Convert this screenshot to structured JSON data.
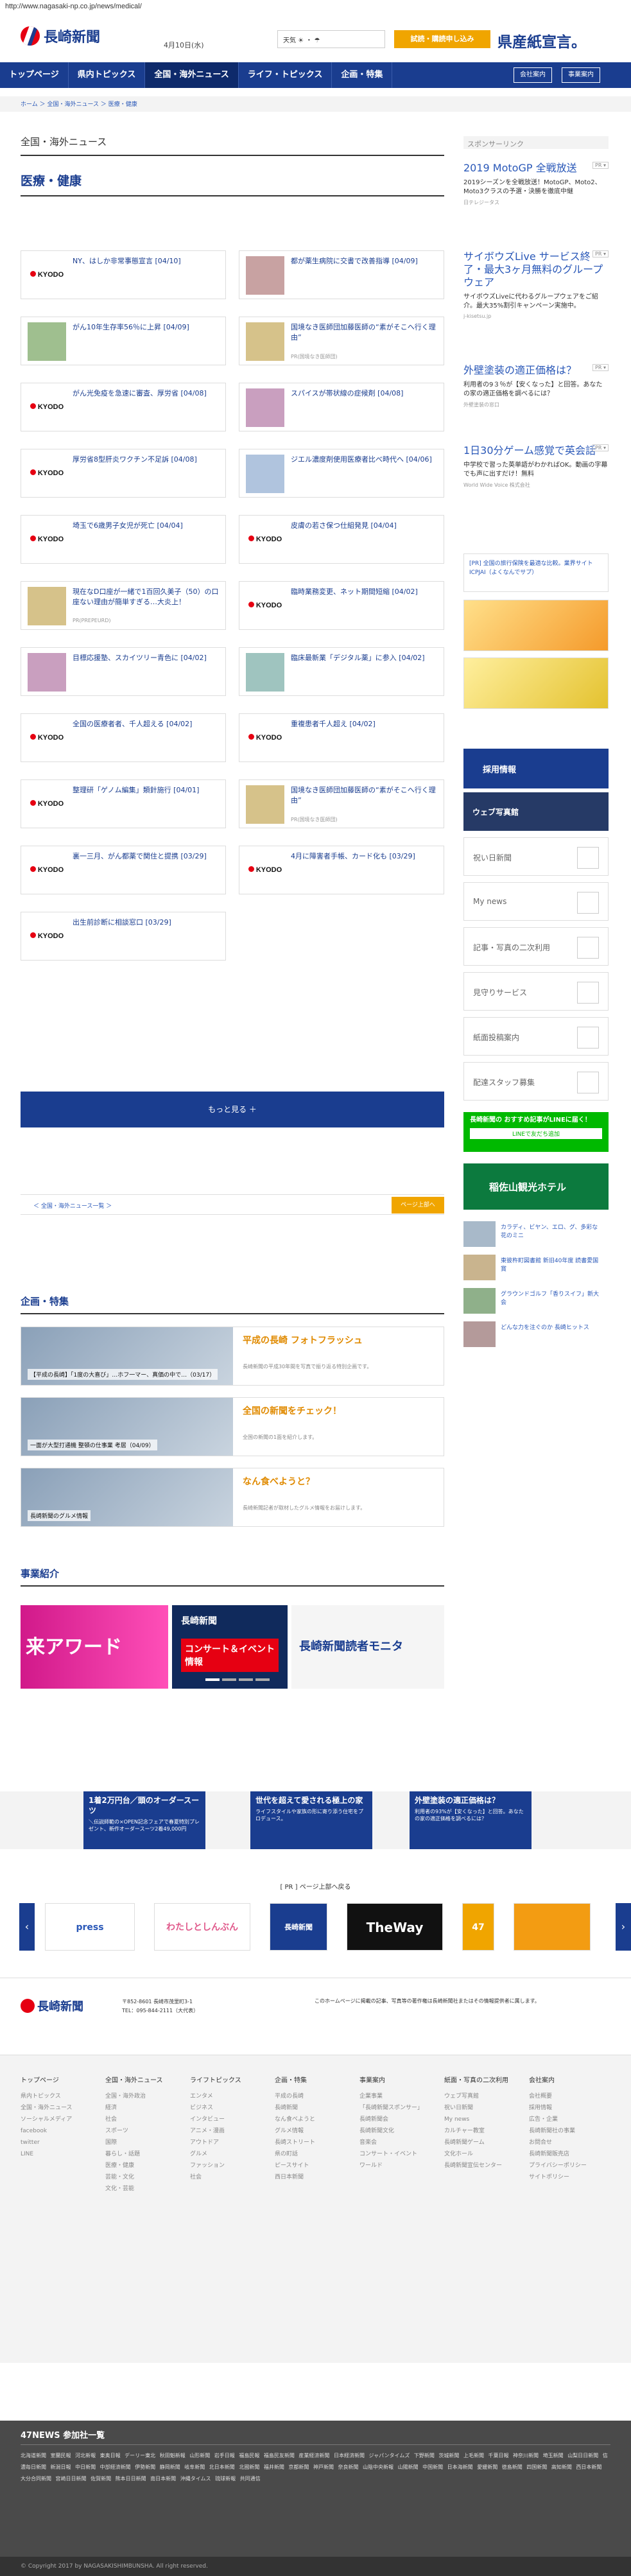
{
  "browser": {
    "url": "http://www.nagasaki-np.co.jp/news/medical/"
  },
  "header": {
    "logo_text": "長崎新聞",
    "date": "4月10日(水)",
    "weather_label": "天気",
    "trial_label": "試読・購読申し込み",
    "ad_text": "県産紙宣言。"
  },
  "nav": {
    "items": [
      "トップページ",
      "県内トピックス",
      "全国・海外ニュース",
      "ライフ・トピックス",
      "企画・特集"
    ],
    "active": 2,
    "company": "会社案内",
    "business": "事業案内"
  },
  "breadcrumb": "ホーム ＞ 全国・海外ニュース ＞ 医療・健康",
  "page": {
    "section": "全国・海外ニュース",
    "subsection": "医療・健康"
  },
  "news": [
    {
      "title": "NY、はしか非常事態宣言 [04/10]",
      "src": "kyodo"
    },
    {
      "title": "都が薬生病院に交書で改善指導 [04/09]",
      "src": "photo"
    },
    {
      "title": "がん10年生存率56％に上昇 [04/09]",
      "src": "photo"
    },
    {
      "title": "国境なき医師団加藤医師の“素がそこへ行く理由”",
      "src": "photo",
      "note": "PR(国境なき医師団)"
    },
    {
      "title": "がん光免疫を急速に審査、厚労省 [04/08]",
      "src": "kyodo"
    },
    {
      "title": "スパイスが帯状線の症候剤 [04/08]",
      "src": "photo"
    },
    {
      "title": "厚労省8型肝炎ワクチン不足訴 [04/08]",
      "src": "kyodo"
    },
    {
      "title": "ジエル濃度剤使用医療者比べ時代へ [04/06]",
      "src": "photo"
    },
    {
      "title": "埼玉で6歳男子女児が死亡 [04/04]",
      "src": "kyodo"
    },
    {
      "title": "皮膚の若さ保つ仕組発見 [04/04]",
      "src": "kyodo"
    },
    {
      "title": "現在なD口座が一緒で1百回久美子（50）の口座ない理由が簡単すぎる…大炎上！",
      "src": "photo",
      "note": "PR(PREPEURD)"
    },
    {
      "title": "臨時業務変更、ネット期間短縮 [04/02]",
      "src": "kyodo"
    },
    {
      "title": "目標応援塾、スカイツリー青色に [04/02]",
      "src": "photo"
    },
    {
      "title": "臨床最新業「デジタル薬」に参入 [04/02]",
      "src": "photo"
    },
    {
      "title": "全国の医療者者、千人超える [04/02]",
      "src": "kyodo"
    },
    {
      "title": "重複患者千人超え [04/02]",
      "src": "kyodo"
    },
    {
      "title": "整理研「ゲノム編集」類針施行 [04/01]",
      "src": "kyodo"
    },
    {
      "title": "国境なき医師団加藤医師の“素がそこへ行く理由”",
      "src": "photo",
      "note": "PR(国境なき医師団)"
    },
    {
      "title": "裏一三月、がん都薬で関住と提携 [03/29]",
      "src": "kyodo"
    },
    {
      "title": "4月に障害者手帳、カード化も [03/29]",
      "src": "kyodo"
    },
    {
      "title": "出生前診断に相談窓口 [03/29]",
      "src": "kyodo"
    }
  ],
  "more_label": "もっと見る ＋",
  "back_label": "＜ 全国・海外ニュース一覧 ＞",
  "pagetop_label": "ページ上部へ",
  "features": {
    "heading": "企画・特集",
    "items": [
      {
        "title": "平成の長崎 フォトフラッシュ",
        "caption": "【平成の長崎】「1度の大喜び」…ホフ一マー、真価の中で…（03/17）",
        "desc": "長崎新聞の平成30年間を写真で振り返る特別企画です。"
      },
      {
        "title": "全国の新聞をチェック！",
        "caption": "一面が大型打通機 整頓の仕事業 考居（04/09）",
        "desc": "全国の新聞の1面を紹介します。"
      },
      {
        "title": "なん食べようと？",
        "caption": "長崎新聞のグルメ情報",
        "desc": "長崎新聞記者が取材したグルメ情報をお届けします。"
      }
    ]
  },
  "business": {
    "heading": "事業紹介",
    "slide1": "来アワード",
    "slide2": "長崎新聞",
    "slide2b": "コンサート＆イベント情報",
    "slide3": "長崎新聞読者モニタ"
  },
  "sidebar": {
    "sponsor_label": "スポンサーリンク",
    "ads": [
      {
        "title": "2019 MotoGP 全戦放送",
        "desc": "2019シーズンを全戦放送！MotoGP、Moto2、Moto3クラスの予選・決勝を徹底中継",
        "src": "日テレジータス"
      },
      {
        "title": "サイボウズLive サービス終了・最大3ヶ月無料のグループウェア",
        "desc": "サイボウズLiveに代わるグループウェアをご紹介。最大35%割引キャンペーン実施中。",
        "src": "j-kisetsu.jp"
      },
      {
        "title": "外壁塗装の適正価格は？",
        "desc": "利用者の9３％が【安くなった】と回答。あなたの家の適正価格を調べるには？",
        "src": "外壁塗装の窓口"
      },
      {
        "title": "1日30分ゲーム感覚で英会話",
        "desc": "中学校で習った英単語がわかればOK。動画の字幕でも声に出すだけ！無料",
        "src": "World Wide Voice 株式会社"
      }
    ],
    "pr_text": "[PR] 全国の旅行保険を最適な比較。業界サイト ICPJAI（よくなんでサプ）",
    "recruit": "採用情報",
    "photo_label": "ウェブ写真館",
    "boxes": [
      "祝い日新聞",
      "My news",
      "記事・写真の二次利用",
      "見守りサービス",
      "紙面投稿案内",
      "配達スタッフ募集"
    ],
    "line_title": "長崎新聞の おすすめ記事がLINEに届く！",
    "line_btn": "LINEで友だち追加",
    "hotel": "稲佐山観光ホテル",
    "side_news": [
      "カラディ、ビヤン、エロ、グ、多彩な花のミニ",
      "東彼杵町図書館 新旧40年度 読書愛国賞",
      "グラウンドゴルフ「香りスイフ」新大会",
      "どんな力を注ぐのか 長崎ヒットス"
    ]
  },
  "footer_ads": [
    {
      "title": "1着2万円台／頭のオーダースーツ",
      "desc": "＼伝説師範の×OPEN記念フェアで春夏特別プレゼント、新作オーダースーツ2着49,000円"
    },
    {
      "title": "世代を超えて愛される極上の家",
      "desc": "ライフスタイルや家族の形に寄り添う住宅をプロデュース。"
    },
    {
      "title": "外壁塗装の適正価格は？",
      "desc": "利用者の93%が【安くなった】と回答。あなたの家の適正価格を調べるには？"
    }
  ],
  "footer_pr": "[ PR ] ページ上部へ戻る",
  "footer_banners": [
    "press",
    "わたしとしんぶん",
    "長崎新聞",
    "TheWay",
    "47"
  ],
  "footer_info": {
    "address": "〒852-8601 長崎市茂里町3-1",
    "tel": "TEL：095-844-2111（大代表）",
    "notice": "このホームページに掲載の記事、写真等の著作権は長崎新聞社またはその情報提供者に属します。"
  },
  "footer_cols": [
    {
      "head": "トップページ",
      "items": [
        "県内トピックス",
        "全国・海外ニュース",
        "ソーシャルメディア",
        "facebook",
        "twitter",
        "LINE"
      ]
    },
    {
      "head": "全国・海外ニュース",
      "items": [
        "全国・海外政治",
        "経済",
        "社会",
        "スポーツ",
        "国際",
        "暮らし・話題",
        "医療・健康",
        "芸能・文化",
        "文化・芸能"
      ]
    },
    {
      "head": "ライフトピックス",
      "items": [
        "エンタメ",
        "ビジネス",
        "インタビュー",
        "アニメ・漫画",
        "アウトドア",
        "グルメ",
        "ファッション",
        "社会"
      ]
    },
    {
      "head": "企画・特集",
      "items": [
        "平成の長崎",
        "長崎新聞",
        "なん食べようと",
        "グルメ情報",
        "長崎ストリート",
        "県の町話",
        "ピースサイト",
        "西日本新聞"
      ]
    },
    {
      "head": "事業案内",
      "items": [
        "企業事業",
        "「長崎新聞スポンサー」",
        "長崎新聞会",
        "長崎新聞文化",
        "音楽会",
        "コンサート・イベント",
        "ワールド"
      ]
    },
    {
      "head": "紙面・写真の二次利用",
      "items": [
        "ウェブ写真館",
        "祝い日新聞",
        "My news",
        "カルチャー教室",
        "長崎新聞ゲーム",
        "文化ホール",
        "長崎新聞宣伝センター"
      ]
    },
    {
      "head": "会社案内",
      "items": [
        "会社概要",
        "採用情報",
        "広告・企業",
        "長崎新聞社の事業",
        "お問合せ",
        "長崎新聞販売店",
        "プライバシーポリシー",
        "サイトポリシー"
      ]
    }
  ],
  "news47": {
    "heading": "47NEWS 参加社一覧",
    "list": "北海道新聞 室蘭民報 河北新報 東奥日報 デーリー東北 秋田魁新報 山形新聞 岩手日報 福島民報 福島民友新聞 産業経済新聞 日本経済新聞 ジャパンタイムズ 下野新聞 茨城新聞 上毛新聞 千葉日報 神奈川新聞 埼玉新聞 山梨日日新聞 信濃毎日新聞 新潟日報 中日新聞 中部経済新聞 伊勢新聞 静岡新聞 岐阜新聞 北日本新聞 北國新聞 福井新聞 京都新聞 神戸新聞 奈良新聞 山陰中央新報 山陽新聞 中国新聞 日本海新聞 愛媛新聞 徳島新聞 四国新聞 高知新聞 西日本新聞 大分合同新聞 宮崎日日新聞 佐賀新聞 熊本日日新聞 南日本新聞 沖縄タイムス 琉球新報 共同通信"
  },
  "copyright": "© Copyright 2017 by NAGASAKISHIMBUNSHA. All right reserved."
}
